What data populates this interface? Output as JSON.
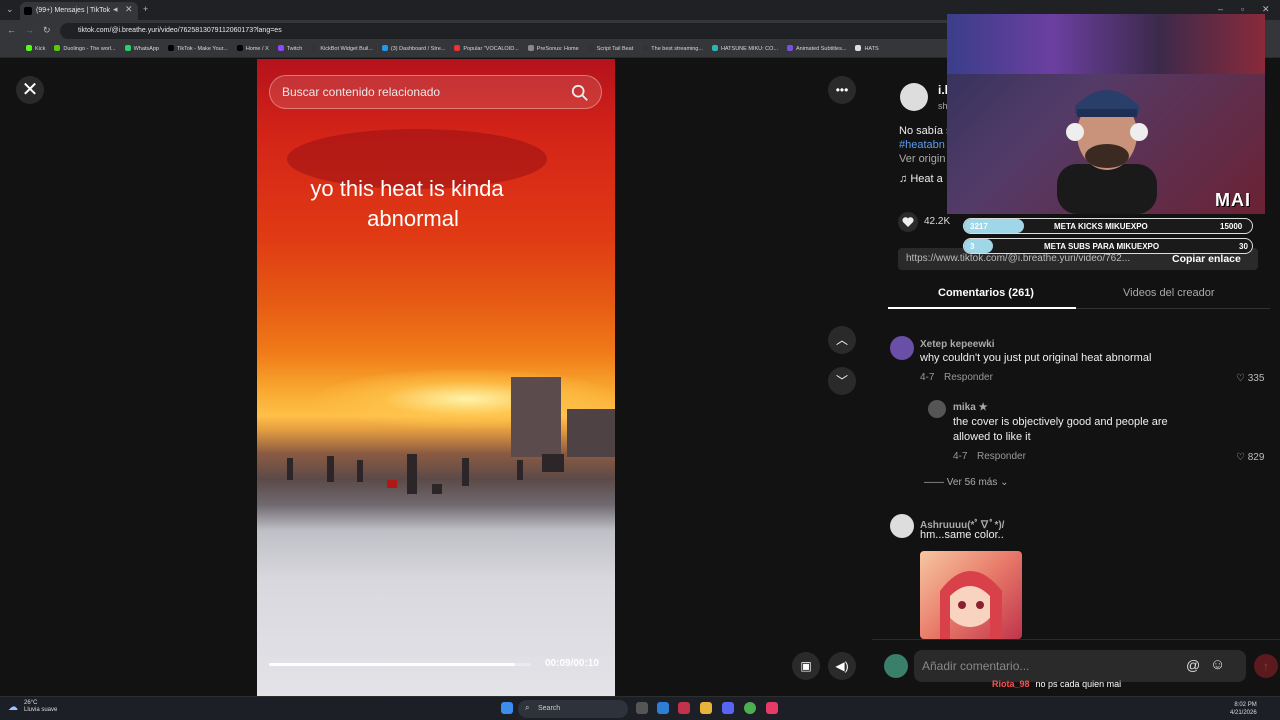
{
  "browser": {
    "tab_title": "(99+) Mensajes | TikTok",
    "url": "tiktok.com/@i.breathe.yuri/video/7625813079112060173?lang=es",
    "bookmarks": [
      "Kick",
      "Duolingo - The worl...",
      "WhatsApp",
      "TikTok - Make Your...",
      "Home / X",
      "Twitch",
      "KickBot Widget Buil...",
      "(3) Dashboard / Stre...",
      "Popular \"VOCALOID...",
      "PreSonus: Home",
      "Script Tail Beat",
      "The best streaming...",
      "HATSUNE MIKU: CO...",
      "Animated Subtitles...",
      "HATS"
    ]
  },
  "video": {
    "search_placeholder": "Buscar contenido relacionado",
    "caption_line1": "yo this heat is kinda",
    "caption_line2": "abnormal",
    "time": "00:09/00:10",
    "progress": 0.94
  },
  "post": {
    "username": "i.l",
    "handle": "sh",
    "desc_line1": "No sabía s",
    "desc_line2": "#heatabn",
    "desc_line3": "Ver origin",
    "music": "Heat a",
    "likes": "42.2K",
    "link": "https://www.tiktok.com/@i.breathe.yuri/video/762...",
    "copy_label": "Copiar enlace"
  },
  "tabs": {
    "comments": "Comentarios (261)",
    "creator": "Videos del creador"
  },
  "comments": [
    {
      "name": "Xetep kepeewki",
      "text": "why couldn't you just put original heat abnormal",
      "date": "4-7",
      "reply": "Responder",
      "likes": "335"
    },
    {
      "name": "mika",
      "text1": "the cover is objectively good and people are",
      "text2": "allowed to like it",
      "date": "4-7",
      "reply": "Responder",
      "likes": "829"
    },
    {
      "name": "Ashruuuu(*ﾟ∇ﾟ*)/",
      "text": "hm...same color.."
    }
  ],
  "more_replies": "Ver 56 más",
  "composer_placeholder": "Añadir comentario...",
  "overlay": {
    "brand": "MAI",
    "goal1_label": "META KICKS MIKUEXPO",
    "goal1_current": "3217",
    "goal1_target": "15000",
    "goal1_progress": 0.21,
    "goal2_label": "META SUBS PARA MIKUEXPO",
    "goal2_current": "3",
    "goal2_target": "30",
    "goal2_progress": 0.1,
    "chat_user": "Riota_98",
    "chat_text": "no ps cada quien mai"
  },
  "taskbar": {
    "temp": "26°C",
    "weather": "Lluvia suave",
    "search": "Search",
    "time": "8:02 PM",
    "date": "4/21/2026"
  },
  "colors": {
    "hashtag": "#5b9cf0",
    "send": "#5a1a1e",
    "goal_fill": "#9fd6e8"
  }
}
